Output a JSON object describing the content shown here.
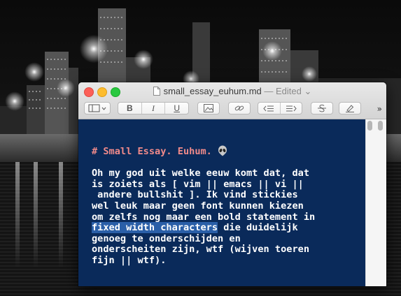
{
  "window": {
    "filename": "small_essay_euhum.md",
    "status": "— Edited",
    "status_chevron": "⌄"
  },
  "toolbar": {
    "sidebar_label": "▯▾",
    "bold_label": "B",
    "italic_label": "I",
    "underline_label": "U",
    "overflow_label": "»"
  },
  "editor": {
    "heading": "# Small Essay. Euhum. ",
    "para_before_selection": "Oh my god uit welke eeuw komt dat, dat\nis zoiets als [ vim || emacs || vi ||\n andere bullshit ]. Ik vind stickies\nwel leuk maar geen font kunnen kiezen\nom zelfs nog maar een bold statement in\n",
    "selection": "fixed width characters",
    "para_after_selection": " die duidelijk\ngenoeg te onderschijden en\nonderscheiten zijn, wtf (wijven toeren\nfijn || wtf)."
  },
  "colors": {
    "editor_bg": "#0a2a5a",
    "heading": "#f08a8a",
    "selection": "#2a5fa8"
  }
}
